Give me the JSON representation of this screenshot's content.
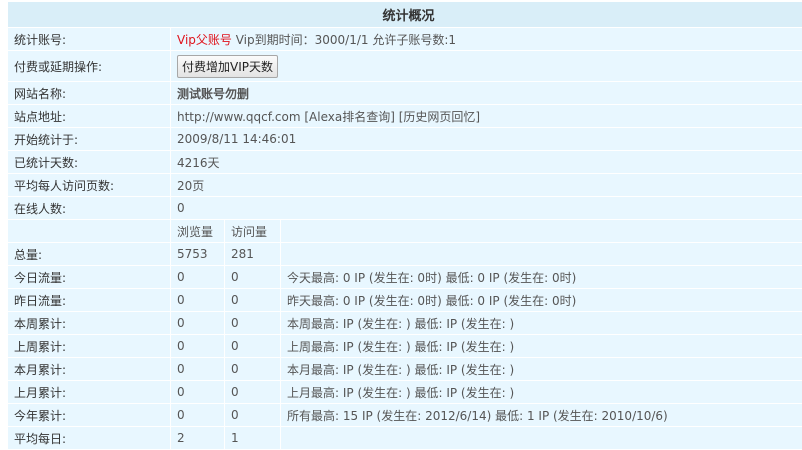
{
  "title": "统计概况",
  "account": {
    "label": "统计账号:",
    "vip": "Vip父账号",
    "expire": "Vip到期时间：3000/1/1 允许子账号数:1"
  },
  "payment": {
    "label": "付费或延期操作:",
    "button": "付费增加VIP天数"
  },
  "site_name": {
    "label": "网站名称:",
    "value": "测试账号勿删"
  },
  "site_url": {
    "label": "站点地址:",
    "url": "http://www.qqcf.com",
    "alexa": "[Alexa排名查询]",
    "history": "[历史网页回忆]"
  },
  "start_time": {
    "label": "开始统计于:",
    "value": "2009/8/11 14:46:01"
  },
  "days": {
    "label": "已统计天数:",
    "value": "4216天"
  },
  "avg_pages": {
    "label": "平均每人访问页数:",
    "value": "20页"
  },
  "online": {
    "label": "在线人数:",
    "value": "0"
  },
  "columns": {
    "pv": "浏览量",
    "uv": "访问量"
  },
  "rows": [
    {
      "label": "总量:",
      "pv": "5753",
      "uv": "281",
      "extra": ""
    },
    {
      "label": "今日流量:",
      "pv": "0",
      "uv": "0",
      "extra": "今天最高:  0 IP (发生在: 0时) 最低:    0 IP (发生在: 0时)"
    },
    {
      "label": "昨日流量:",
      "pv": "0",
      "uv": "0",
      "extra": "昨天最高:  0 IP (发生在: 0时) 最低:    0 IP (发生在: 0时)"
    },
    {
      "label": "本周累计:",
      "pv": "0",
      "uv": "0",
      "extra": "本周最高:  IP (发生在: ) 最低:   IP (发生在: )"
    },
    {
      "label": "上周累计:",
      "pv": "0",
      "uv": "0",
      "extra": "上周最高:  IP (发生在: ) 最低:   IP (发生在: )"
    },
    {
      "label": "本月累计:",
      "pv": "0",
      "uv": "0",
      "extra": "本月最高:  IP (发生在: ) 最低:   IP (发生在: )"
    },
    {
      "label": "上月累计:",
      "pv": "0",
      "uv": "0",
      "extra": "上月最高:  IP (发生在: ) 最低:   IP (发生在: )"
    },
    {
      "label": "今年累计:",
      "pv": "0",
      "uv": "0",
      "extra": "所有最高:  15 IP (发生在: 2012/6/14) 最低:    1 IP (发生在: 2010/10/6)"
    },
    {
      "label": "平均每日:",
      "pv": "2",
      "uv": "1",
      "extra": ""
    }
  ]
}
